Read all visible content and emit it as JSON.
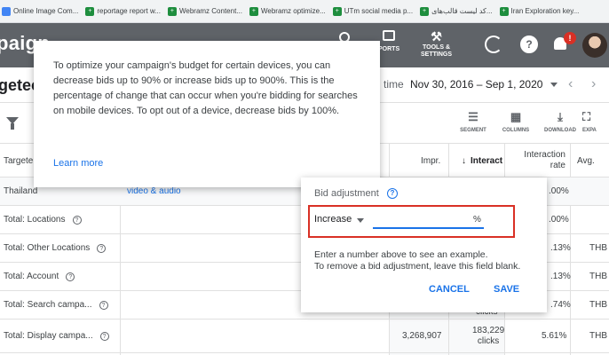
{
  "bookmarks": [
    {
      "label": "Online Image Com...",
      "icon": "image-icon"
    },
    {
      "label": "reportage report w...",
      "icon": "sheets-icon"
    },
    {
      "label": "Webramz Content...",
      "icon": "sheets-icon"
    },
    {
      "label": "Webramz optimize...",
      "icon": "sheets-icon"
    },
    {
      "label": "UTm social media p...",
      "icon": "sheets-icon"
    },
    {
      "label": "کد لیست قالب‌های...",
      "icon": "sheets-icon"
    },
    {
      "label": "Iran Exploration key...",
      "icon": "sheets-icon"
    }
  ],
  "header": {
    "title": "paign",
    "reports_label": "PORTS",
    "tools_label_1": "TOOLS &",
    "tools_label_2": "SETTINGS",
    "notification_count": "!"
  },
  "subheader": {
    "title": "getec",
    "time_label": "time",
    "date_range": "Nov 30, 2016 – Sep 1, 2020"
  },
  "toolbar": {
    "segment": "SEGMENT",
    "columns": "COLUMNS",
    "download": "DOWNLOAD",
    "expand": "EXPA"
  },
  "table": {
    "headers": {
      "targeted": "Targete",
      "impr": "Impr.",
      "interactions": "Interact",
      "interaction_rate_1": "Interaction",
      "interaction_rate_2": "rate",
      "avg": "Avg."
    },
    "rows": [
      {
        "name": "Thailand",
        "type": "video & audio",
        "impr": "",
        "interactions": "",
        "rate": ".00%",
        "avg": ""
      },
      {
        "name": "Total: Locations",
        "type": "",
        "impr": "",
        "interactions": "",
        "rate": ".00%",
        "avg": ""
      },
      {
        "name": "Total: Other Locations",
        "type": "",
        "impr": "",
        "interactions": "",
        "rate": ".13%",
        "avg": "THB"
      },
      {
        "name": "Total: Account",
        "type": "",
        "impr": "",
        "interactions": "",
        "rate": ".13%",
        "avg": "THB"
      },
      {
        "name": "Total: Search campa...",
        "type": "",
        "impr": "",
        "interactions": "clicks",
        "rate": ".74%",
        "avg": "THB"
      },
      {
        "name": "Total: Display campa...",
        "type": "",
        "impr": "3,268,907",
        "interactions": "183,229",
        "interactions_unit": "clicks",
        "rate": "5.61%",
        "avg": "THB"
      }
    ]
  },
  "tooltip": {
    "text": "To optimize your campaign's budget for certain devices, you can decrease bids up to 90% or increase bids up to 900%. This is the percentage of change that can occur when you're bidding for searches on mobile devices. To opt out of a device, decrease bids by 100%.",
    "link": "Learn more"
  },
  "bid_dialog": {
    "label": "Bid adjustment",
    "direction": "Increase",
    "input_value": "",
    "unit": "%",
    "help_line_1": "Enter a number above to see an example.",
    "help_line_2": "To remove a bid adjustment, leave this field blank.",
    "cancel": "CANCEL",
    "save": "SAVE"
  }
}
